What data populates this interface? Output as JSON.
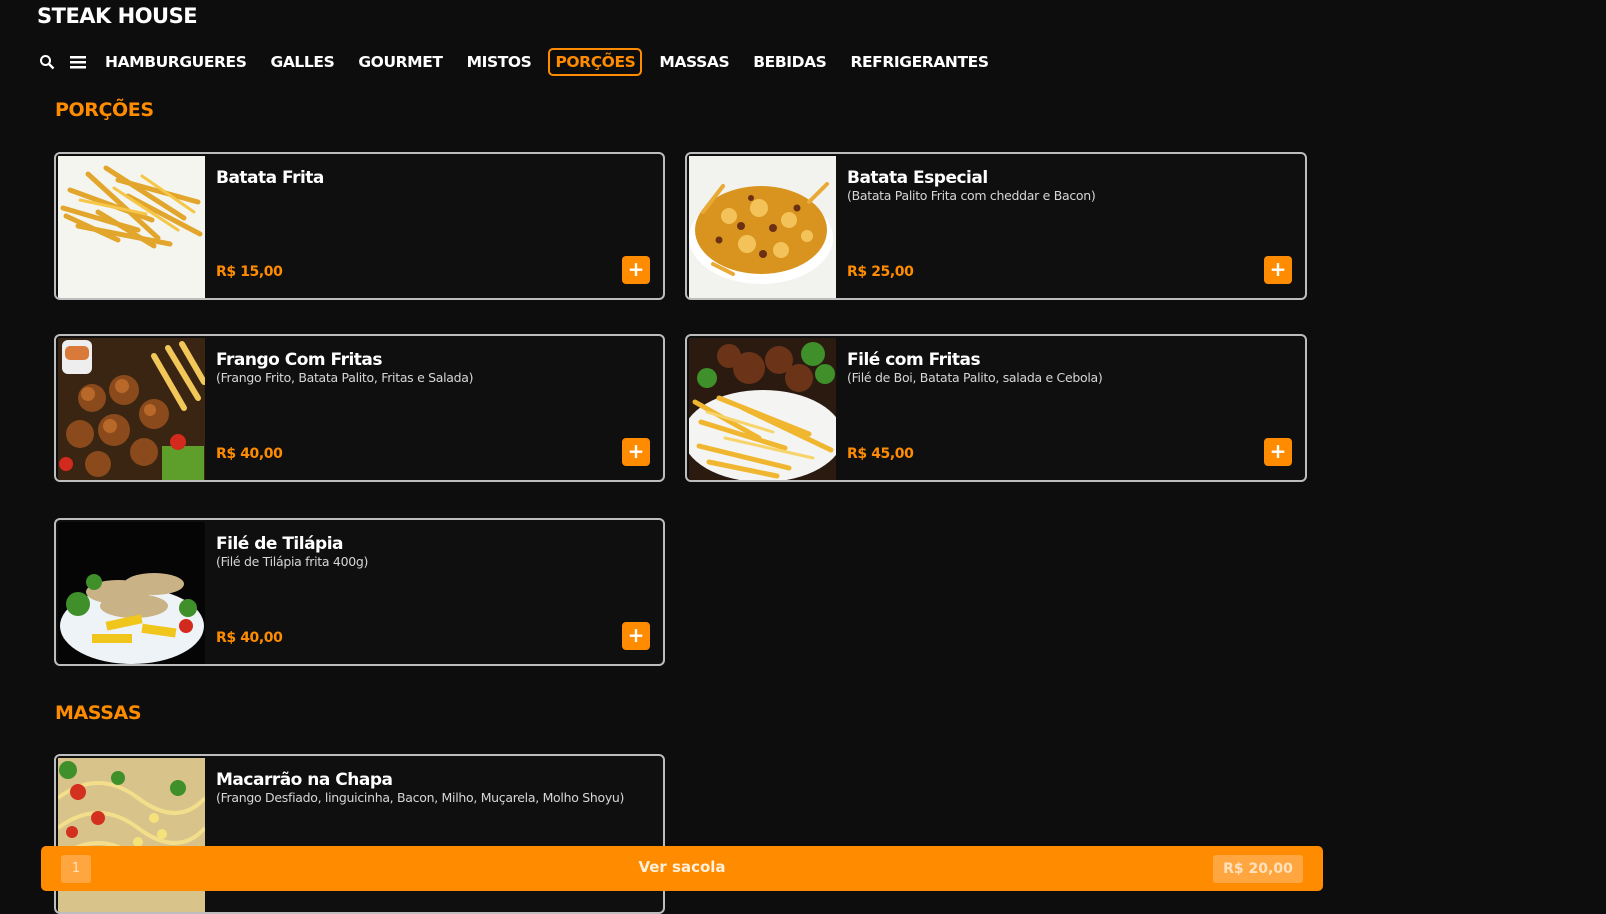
{
  "header": {
    "brand": "STEAK HOUSE"
  },
  "nav": {
    "categories": [
      "HAMBURGUERES",
      "GALLES",
      "GOURMET",
      "MISTOS",
      "PORÇÕES",
      "MASSAS",
      "BEBIDAS",
      "REFRIGERANTES"
    ],
    "active": "PORÇÕES",
    "icons": [
      "search-icon",
      "menu-icon"
    ]
  },
  "sections": [
    {
      "title": "PORÇÕES",
      "items": [
        {
          "name": "Batata Frita",
          "desc": "",
          "price": "R$ 15,00"
        },
        {
          "name": "Batata Especial",
          "desc": "(Batata Palito Frita com cheddar e Bacon)",
          "price": "R$ 25,00"
        },
        {
          "name": "Frango Com Fritas",
          "desc": "(Frango Frito, Batata Palito, Fritas e Salada)",
          "price": "R$ 40,00"
        },
        {
          "name": "Filé com Fritas",
          "desc": "(Filé de Boi, Batata Palito, salada e Cebola)",
          "price": "R$ 45,00"
        },
        {
          "name": "Filé de Tilápia",
          "desc": "(Filé de Tilápia frita 400g)",
          "price": "R$ 40,00"
        }
      ]
    },
    {
      "title": "MASSAS",
      "items": [
        {
          "name": "Macarrão na Chapa",
          "desc": "(Frango Desfiado, linguicinha, Bacon, Milho, Muçarela, Molho Shoyu)",
          "price": ""
        }
      ]
    }
  ],
  "add_label": "+",
  "bag": {
    "count": "1",
    "label": "Ver sacola",
    "total": "R$ 20,00"
  },
  "colors": {
    "accent": "#ff8c00",
    "background": "#0d0d0d",
    "card_border": "#bdbdbd"
  }
}
